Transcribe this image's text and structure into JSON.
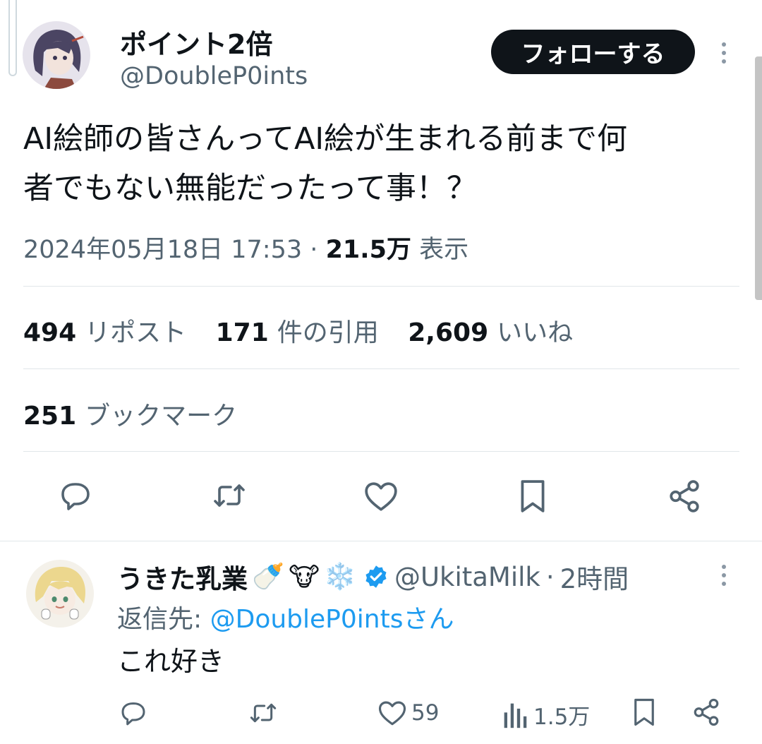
{
  "main_tweet": {
    "display_name": "ポイント2倍",
    "handle": "@DoubleP0ints",
    "follow_label": "フォローする",
    "text_line1": "AI絵師の皆さんってAI絵が生まれる前まで何",
    "text_line2": "者でもない無能だったって事！？",
    "timestamp": "2024年05月18日 17:53",
    "separator": "·",
    "views_count": "21.5万",
    "views_label": "表示",
    "stats": {
      "reposts_count": "494",
      "reposts_label": "リポスト",
      "quotes_count": "171",
      "quotes_label": "件の引用",
      "likes_count": "2,609",
      "likes_label": "いいね",
      "bookmarks_count": "251",
      "bookmarks_label": "ブックマーク"
    },
    "actions": [
      "reply-icon",
      "repost-icon",
      "like-icon",
      "bookmark-icon",
      "share-icon"
    ]
  },
  "reply_tweet": {
    "display_name": "うきた乳業",
    "name_emojis": [
      "🍼",
      "🐮",
      "❄️"
    ],
    "verified": true,
    "handle": "@UkitaMilk",
    "separator": "·",
    "time": "2時間",
    "replying_to_label": "返信先:",
    "replying_to_handle": "@DoubleP0intsさん",
    "text": "これ好き",
    "likes_count": "59",
    "views_count": "1.5万"
  },
  "colors": {
    "text": "#0f1419",
    "muted": "#536471",
    "link": "#1d9bf0",
    "follow_bg": "#0f1419",
    "divider": "#e1e6ea"
  }
}
